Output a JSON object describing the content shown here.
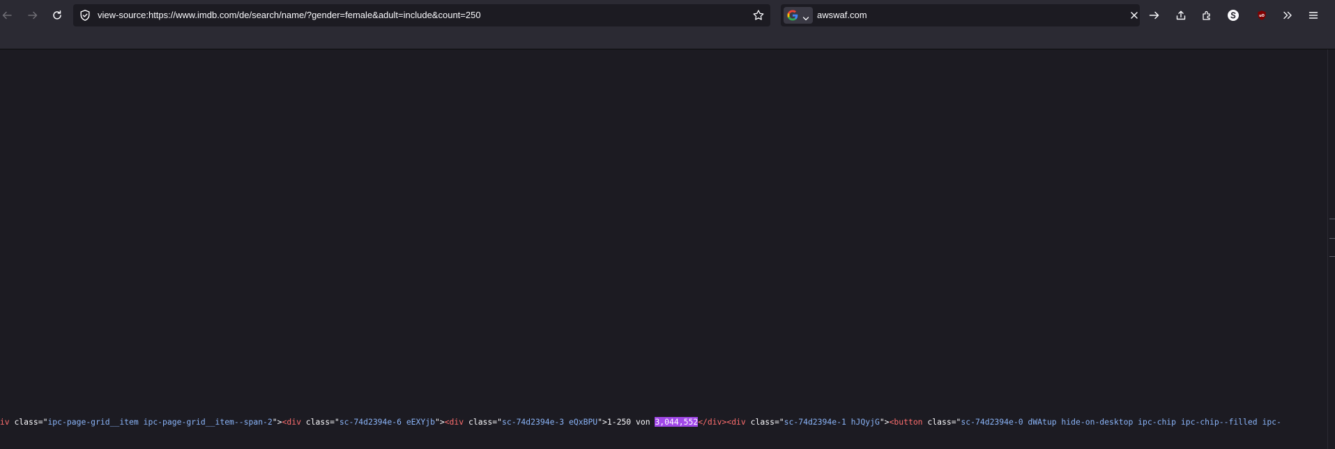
{
  "browser": {
    "url": "view-source:https://www.imdb.com/de/search/name/?gender=female&adult=include&count=250",
    "search": {
      "engine_icon": "google-icon",
      "value": "awswaf.com"
    },
    "nav_icons": [
      "back-arrow-icon",
      "forward-arrow-icon",
      "reload-icon"
    ],
    "toolbar_icons": [
      "share-icon",
      "extensions-icon",
      "sync-account-icon",
      "ublock-icon",
      "overflow-chevrons-icon",
      "menu-icon"
    ],
    "accent_highlight": "#a148e8"
  },
  "source": {
    "tokens": [
      {
        "t": "tag",
        "v": "div"
      },
      {
        "t": "txt",
        "v": " "
      },
      {
        "t": "attr",
        "v": "class"
      },
      {
        "t": "txt",
        "v": "=\""
      },
      {
        "t": "val",
        "v": "ipc-page-grid__item ipc-page-grid__item--span-2"
      },
      {
        "t": "txt",
        "v": "\">"
      },
      {
        "t": "tag",
        "v": "<div"
      },
      {
        "t": "txt",
        "v": " "
      },
      {
        "t": "attr",
        "v": "class"
      },
      {
        "t": "txt",
        "v": "=\""
      },
      {
        "t": "val",
        "v": "sc-74d2394e-6 eEXYjb"
      },
      {
        "t": "txt",
        "v": "\">"
      },
      {
        "t": "tag",
        "v": "<div"
      },
      {
        "t": "txt",
        "v": " "
      },
      {
        "t": "attr",
        "v": "class"
      },
      {
        "t": "txt",
        "v": "=\""
      },
      {
        "t": "val",
        "v": "sc-74d2394e-3 eQxBPU"
      },
      {
        "t": "txt",
        "v": "\">1-250 von "
      },
      {
        "t": "hl",
        "v": "3,044,552"
      },
      {
        "t": "tag",
        "v": "</div>"
      },
      {
        "t": "tag",
        "v": "<div"
      },
      {
        "t": "txt",
        "v": " "
      },
      {
        "t": "attr",
        "v": "class"
      },
      {
        "t": "txt",
        "v": "=\""
      },
      {
        "t": "val",
        "v": "sc-74d2394e-1 hJQyjG"
      },
      {
        "t": "txt",
        "v": "\">"
      },
      {
        "t": "tag",
        "v": "<button"
      },
      {
        "t": "txt",
        "v": " "
      },
      {
        "t": "attr",
        "v": "class"
      },
      {
        "t": "txt",
        "v": "=\""
      },
      {
        "t": "val",
        "v": "sc-74d2394e-0 dWAtup hide-on-desktop ipc-chip ipc-chip--filled ipc-"
      }
    ]
  }
}
